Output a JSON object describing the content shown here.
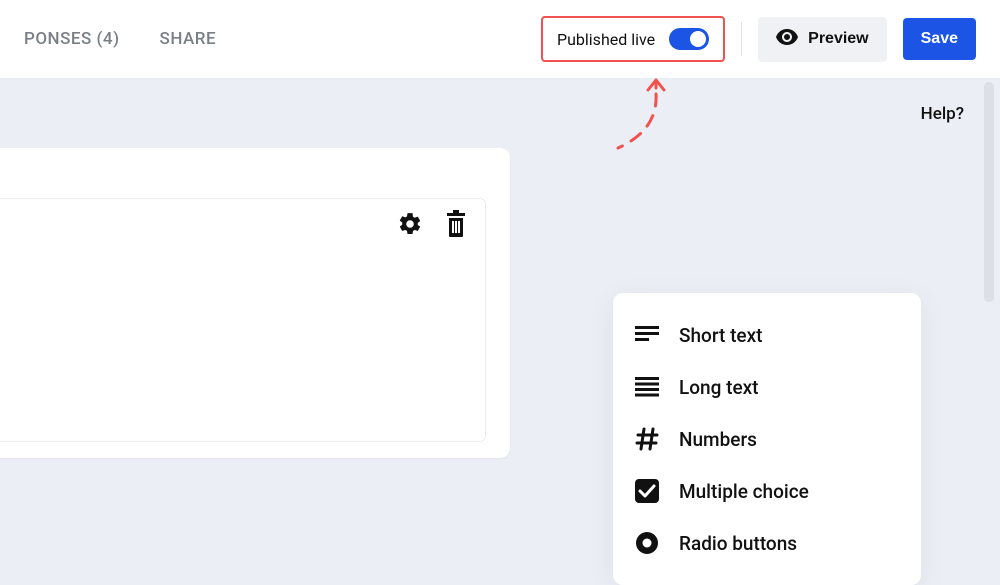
{
  "header": {
    "tabs": [
      {
        "label": "PONSES (4)"
      },
      {
        "label": "SHARE"
      }
    ],
    "publish_label": "Published live",
    "preview_label": "Preview",
    "save_label": "Save"
  },
  "help_label": "Help?",
  "field_menu": {
    "items": [
      {
        "label": "Short text",
        "icon": "short-text-icon"
      },
      {
        "label": "Long text",
        "icon": "long-text-icon"
      },
      {
        "label": "Numbers",
        "icon": "hash-icon"
      },
      {
        "label": "Multiple choice",
        "icon": "checkbox-icon"
      },
      {
        "label": "Radio buttons",
        "icon": "radio-icon"
      }
    ]
  }
}
